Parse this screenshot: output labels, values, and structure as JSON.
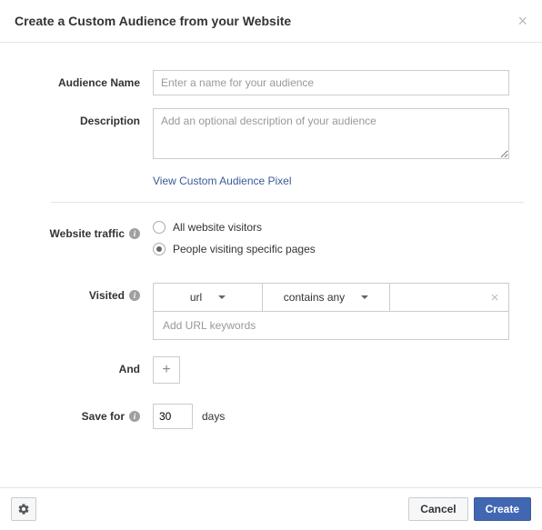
{
  "header": {
    "title": "Create a Custom Audience from your Website"
  },
  "labels": {
    "audience_name": "Audience Name",
    "description": "Description",
    "website_traffic": "Website traffic",
    "visited": "Visited",
    "and": "And",
    "save_for": "Save for",
    "days": "days"
  },
  "placeholders": {
    "audience_name": "Enter a name for your audience",
    "description": "Add an optional description of your audience",
    "url_keywords": "Add URL keywords"
  },
  "links": {
    "view_pixel": "View Custom Audience Pixel"
  },
  "traffic_options": {
    "all": "All website visitors",
    "specific": "People visiting specific pages",
    "selected": "specific"
  },
  "visited": {
    "field": "url",
    "operator": "contains any"
  },
  "save_for_value": "30",
  "footer": {
    "cancel": "Cancel",
    "create": "Create"
  }
}
